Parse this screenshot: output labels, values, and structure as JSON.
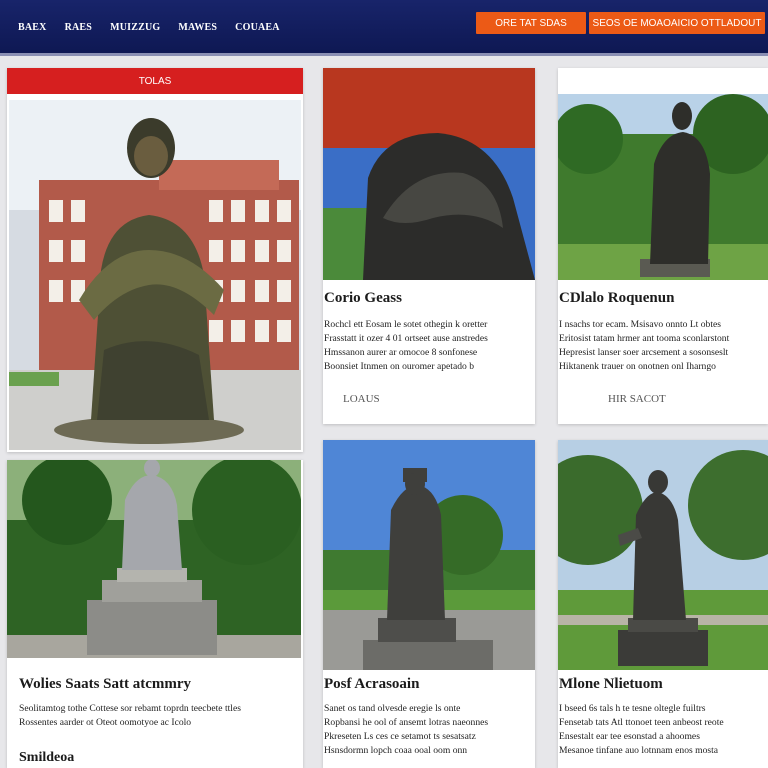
{
  "header": {
    "nav": [
      "BAEX",
      "RAES",
      "MUIZZUG",
      "MAWES",
      "COUAEA"
    ],
    "btn_primary": "ORE   TAT SDAS",
    "btn_secondary": "SEOS OE MOAOAICIO OTTLADOUT"
  },
  "cards": {
    "feature": {
      "banner": "TOLAS"
    },
    "c1": {
      "title": "Corio Geass",
      "lines": [
        "Rochcl ett Eosam le sotet othegin k oretter",
        "Frasstatt it ozer 4 01 ortseet ause anstredes",
        "Hmssanon aurer ar omocoe 8 sonfonese",
        "Boonsiet Itnmen on ouromer apetado b"
      ],
      "more": "LOAUS"
    },
    "c2": {
      "title": "CDlalo Roquenun",
      "lines": [
        "I nsachs tor ecam. Msisavo onnto Lt obtes",
        "Eritosist tatam hrmer ant tooma sconlarstont",
        "Hepresist lanser soer arcsement a sosonseslt",
        "Hiktanenk trauer on onotnen onl Iharngo"
      ],
      "more": "HIR SACOT"
    },
    "c3": {
      "title": "Wolies Saats Satt atcmmry",
      "lines": [
        "Seolitamtog tothe Cottese sor rebamt toprdn teecbete ttles",
        "Rossentes aarder ot Oteot oomotyoe ac Icolo"
      ],
      "more": "Smildeoa"
    },
    "c4": {
      "title": "Posf Acrasoain",
      "lines": [
        "Sanet os tand olvesde eregie ls onte",
        "Ropbansi he ool of ansemt lotras naeonnes",
        "Pkreseten Ls ces ce setamot ts sesatsatz",
        "Hsnsdormn lopch coaa ooal oom onn"
      ]
    },
    "c5": {
      "title": "Mlone Nlietuom",
      "lines": [
        "I bseed 6s tals h te tesne oltegle fuiltrs",
        "Fensetab tats Atl ttonoet teen anbeost reote",
        "Ensestalt ear tee esonstad a ahoomes",
        "Mesanoe tinfane auo lotnnam enos mosta"
      ]
    }
  },
  "colors": {
    "header": "#14205f",
    "accent": "#ec5a16",
    "banner": "#d61f1f"
  }
}
